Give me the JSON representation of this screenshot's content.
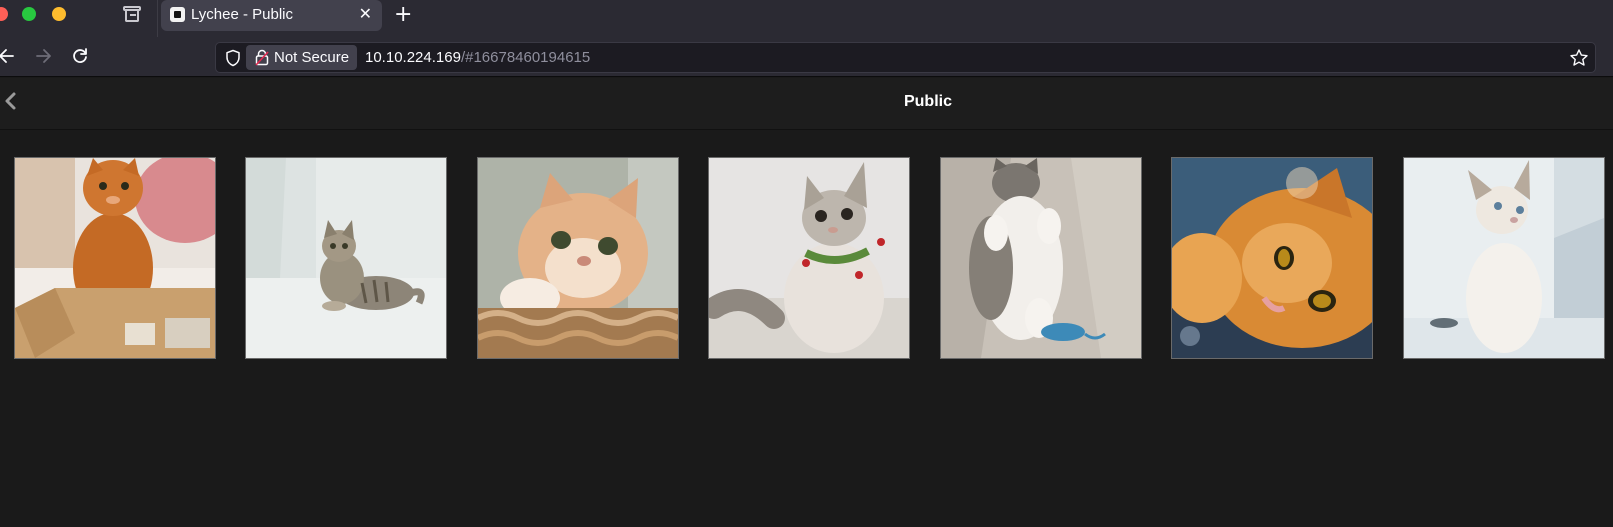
{
  "browser": {
    "tab": {
      "title": "Lychee - Public",
      "close_glyph": "✕",
      "favicon": "lychee-favicon-icon"
    },
    "new_tab_glyph": "+",
    "security": {
      "label": "Not Secure"
    },
    "url": {
      "host": "10.10.224.169",
      "rest": "/#16678460194615"
    },
    "icons": [
      "back-arrow-icon",
      "forward-arrow-icon",
      "reload-icon",
      "shield-icon",
      "lock-insecure-icon",
      "bookmark-star-icon",
      "tab-list-icon"
    ],
    "colors": {
      "chrome": "#2b2a33",
      "active_tab": "#42414d",
      "urlbar": "#1c1b22",
      "close": "#ff5f57",
      "minimize": "#febc2e",
      "maximize": "#28c840"
    }
  },
  "page": {
    "title": "Public",
    "background": "#1a1a1a",
    "photos": [
      {
        "subject": "orange-cat-in-cardboard-box"
      },
      {
        "subject": "grey-tabby-kitten-lying"
      },
      {
        "subject": "orange-white-cat-on-wicker"
      },
      {
        "subject": "fluffy-grey-kitten-with-collar"
      },
      {
        "subject": "grey-white-kitten-on-back"
      },
      {
        "subject": "orange-fluffy-cat-lying"
      },
      {
        "subject": "white-siamese-kitten"
      }
    ]
  }
}
